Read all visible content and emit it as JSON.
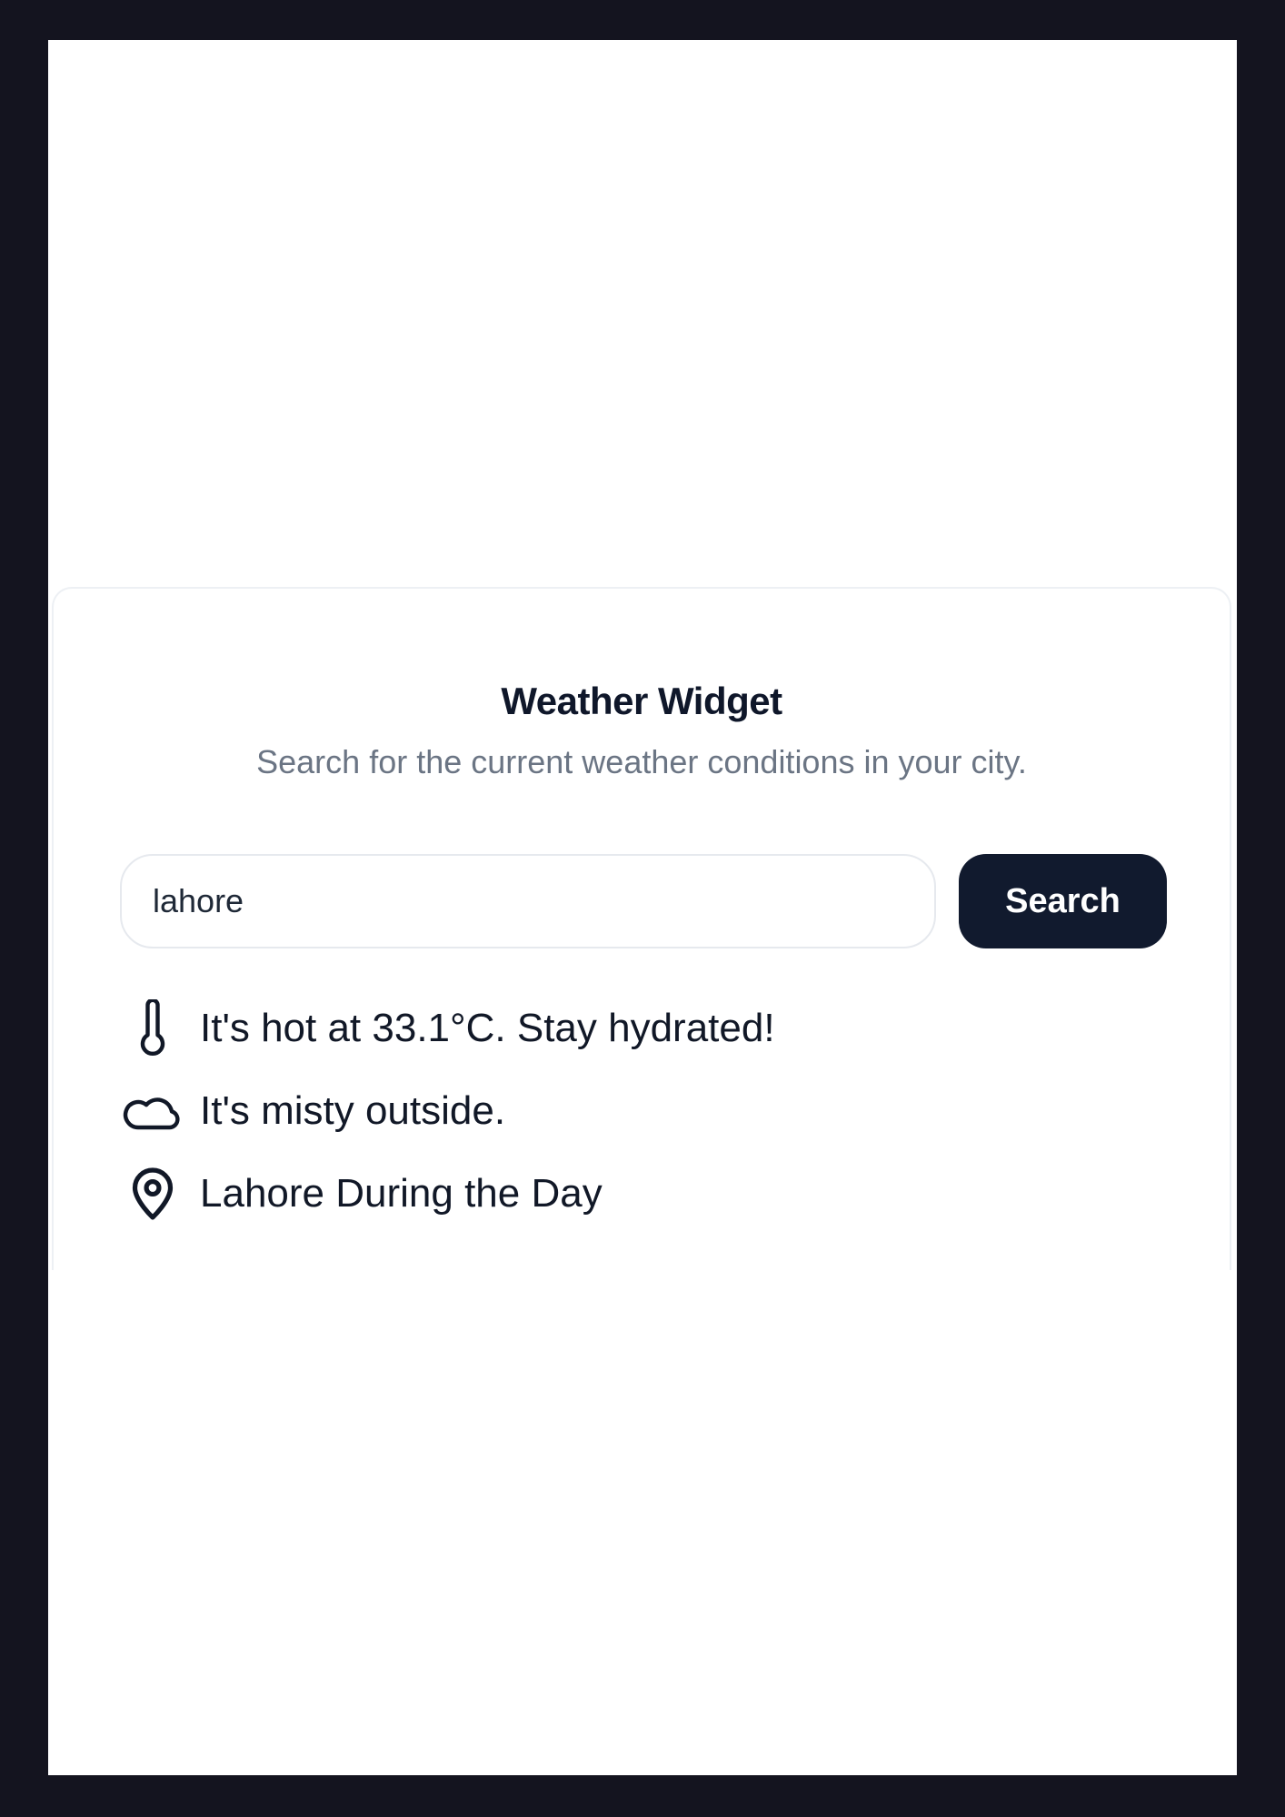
{
  "widget": {
    "title": "Weather Widget",
    "subtitle": "Search for the current weather conditions in your city."
  },
  "search": {
    "value": "lahore",
    "placeholder": "",
    "button_label": "Search"
  },
  "results": {
    "temperature": {
      "icon": "thermometer-icon",
      "text": "It's hot at 33.1°C. Stay hydrated!"
    },
    "condition": {
      "icon": "cloud-icon",
      "text": "It's misty outside."
    },
    "location": {
      "icon": "map-pin-icon",
      "text": "Lahore During the Day"
    }
  },
  "colors": {
    "page_frame": "#14141f",
    "card_background": "#ffffff",
    "primary_button": "#111a2e",
    "title_text": "#0f172a",
    "muted_text": "#6b7584"
  }
}
